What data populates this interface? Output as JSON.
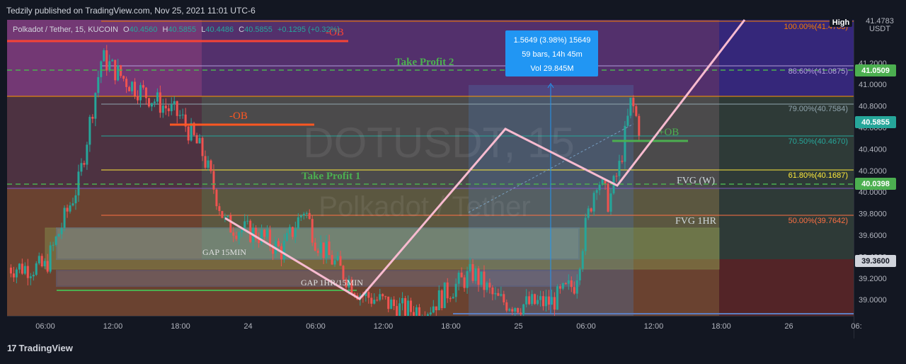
{
  "header": {
    "published": "Tedzily published on TradingView.com, Nov 25, 2021 11:01 UTC-6"
  },
  "footer": {
    "brand": "TradingView"
  },
  "legend": {
    "symbol": "Polkadot / Tether, 15, KUCOIN",
    "o_label": "O",
    "o": "40.4560",
    "h_label": "H",
    "h": "40.5855",
    "l_label": "L",
    "l": "40.4486",
    "c_label": "C",
    "c": "40.5855",
    "change": "+0.1295 (+0.32%)"
  },
  "watermark": {
    "ticker": "DOTUSDT, 15",
    "name": "Polkadot / Tether"
  },
  "annotations": {
    "ob_top": "-OB",
    "ob_mid": "-OB",
    "ob_plus": "+OB",
    "tp2": "Take Profit 2",
    "tp1": "Take Profit 1",
    "fvg_w": "FVG (W)",
    "fvg_1hr": "FVG 1HR",
    "gap15": "GAP 15MIN",
    "gap1hr": "GAP 1HR/15MIN"
  },
  "fib_labels": [
    "100.00%(41.4783)",
    "88.60%(41.0875)",
    "79.00%(40.7584)",
    "70.50%(40.4670)",
    "61.80%(40.1687)",
    "50.00%(39.7642)"
  ],
  "measure": {
    "line1": "1.5649 (3.98%) 15649",
    "line2": "59 bars, 14h 45m",
    "line3": "Vol 29.845M"
  },
  "price_axis": {
    "currency": "USDT",
    "ticks": [
      "41.2000",
      "41.0000",
      "40.8000",
      "40.6000",
      "40.4000",
      "40.2000",
      "40.0000",
      "39.8000",
      "39.6000",
      "39.4000",
      "39.2000",
      "39.0000"
    ],
    "tags": {
      "high_label": "High",
      "high_value": "41.4783",
      "tp2": "41.0509",
      "last": "40.5855",
      "tp1": "40.0398",
      "low": "39.3600"
    }
  },
  "time_axis": [
    "06:00",
    "12:00",
    "18:00",
    "24",
    "06:00",
    "12:00",
    "18:00",
    "25",
    "06:00",
    "12:00",
    "18:00",
    "26",
    "06:"
  ],
  "colors": {
    "background": "#131722",
    "up": "#26a69a",
    "down": "#ef5350",
    "tp_line": "#4caf50",
    "path": "#f8bbd0",
    "ob_red": "#f44336",
    "ob_green": "#4caf50"
  },
  "chart_data": {
    "type": "candlestick",
    "title": "Polkadot / Tether, 15, KUCOIN",
    "ylim": [
      38.85,
      41.6
    ],
    "x_ticks": [
      "06:00",
      "12:00",
      "18:00",
      "24",
      "06:00",
      "12:00",
      "18:00",
      "25",
      "06:00",
      "12:00",
      "18:00",
      "26"
    ],
    "legend_ohlc": {
      "open": 40.456,
      "high": 40.5855,
      "low": 40.4486,
      "close": 40.5855,
      "change": 0.1295,
      "change_pct": 0.32
    },
    "levels": {
      "take_profit_2": 41.0509,
      "take_profit_1": 40.0398,
      "fib_100": 41.4783,
      "fib_88_6": 41.0875,
      "fib_79": 40.7584,
      "fib_70_5": 40.467,
      "fib_61_8": 40.1687,
      "fib_50": 39.7642,
      "low": 39.36
    },
    "measure": {
      "price_change": 1.5649,
      "percent": 3.98,
      "bars": 59,
      "duration": "14h 45m",
      "volume": "29.845M"
    },
    "price_path": [
      {
        "t": "Nov 23 06:00",
        "close": 39.3
      },
      {
        "t": "Nov 23 09:00",
        "close": 40.1
      },
      {
        "t": "Nov 23 11:00",
        "close": 41.25
      },
      {
        "t": "Nov 23 13:00",
        "close": 41.05
      },
      {
        "t": "Nov 23 15:00",
        "close": 40.9
      },
      {
        "t": "Nov 23 18:00",
        "close": 40.7
      },
      {
        "t": "Nov 23 20:00",
        "close": 40.35
      },
      {
        "t": "Nov 23 22:00",
        "close": 39.7
      },
      {
        "t": "Nov 24 01:00",
        "close": 39.6
      },
      {
        "t": "Nov 24 03:00",
        "close": 39.45
      },
      {
        "t": "Nov 24 05:00",
        "close": 39.85
      },
      {
        "t": "Nov 24 06:00",
        "close": 39.55
      },
      {
        "t": "Nov 24 08:00",
        "close": 39.3
      },
      {
        "t": "Nov 24 10:00",
        "close": 39.05
      },
      {
        "t": "Nov 24 12:00",
        "close": 38.98
      },
      {
        "t": "Nov 24 14:00",
        "close": 38.9
      },
      {
        "t": "Nov 24 16:00",
        "close": 38.92
      },
      {
        "t": "Nov 24 18:00",
        "close": 39.1
      },
      {
        "t": "Nov 24 20:00",
        "close": 39.25
      },
      {
        "t": "Nov 24 22:00",
        "close": 39.0
      },
      {
        "t": "Nov 25 00:00",
        "close": 38.95
      },
      {
        "t": "Nov 25 03:00",
        "close": 38.98
      },
      {
        "t": "Nov 25 05:00",
        "close": 39.15
      },
      {
        "t": "Nov 25 06:00",
        "close": 39.7
      },
      {
        "t": "Nov 25 07:00",
        "close": 40.15
      },
      {
        "t": "Nov 25 08:00",
        "close": 39.9
      },
      {
        "t": "Nov 25 09:00",
        "close": 40.25
      },
      {
        "t": "Nov 25 10:00",
        "close": 40.85
      },
      {
        "t": "Nov 25 10:45",
        "close": 40.5855
      }
    ]
  }
}
